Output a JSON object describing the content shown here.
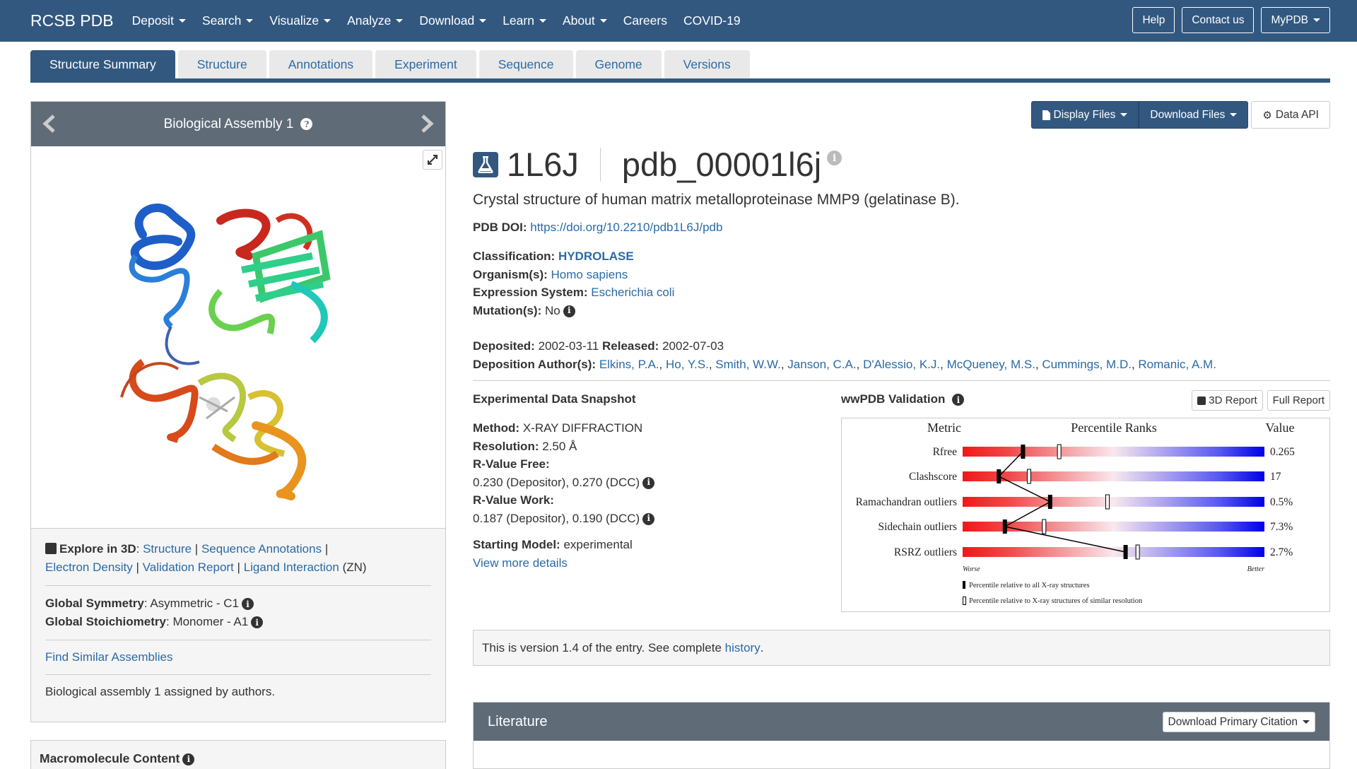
{
  "nav": {
    "brand": "RCSB PDB",
    "items": [
      "Deposit",
      "Search",
      "Visualize",
      "Analyze",
      "Download",
      "Learn",
      "About",
      "Careers",
      "COVID-19"
    ],
    "buttons": [
      "Help",
      "Contact us",
      "MyPDB"
    ]
  },
  "tabs": [
    "Structure Summary",
    "Structure",
    "Annotations",
    "Experiment",
    "Sequence",
    "Genome",
    "Versions"
  ],
  "assembly": {
    "title": "Biological Assembly 1",
    "explore_label": "Explore in 3D",
    "explore_links": [
      "Structure",
      "Sequence Annotations",
      "Electron Density",
      "Validation Report",
      "Ligand Interaction"
    ],
    "ligand_note": "(ZN)",
    "symmetry_label": "Global Symmetry",
    "symmetry_value": "Asymmetric - C1",
    "stoich_label": "Global Stoichiometry",
    "stoich_value": "Monomer - A1",
    "find_similar": "Find Similar Assemblies",
    "assigned_note": "Biological assembly 1 assigned by authors."
  },
  "toolbar": {
    "display_files": "Display Files",
    "download_files": "Download Files",
    "data_api": "Data API"
  },
  "entry": {
    "id": "1L6J",
    "ext_id": "pdb_00001l6j",
    "title": "Crystal structure of human matrix metalloproteinase MMP9 (gelatinase B).",
    "doi_label": "PDB DOI:",
    "doi": "https://doi.org/10.2210/pdb1L6J/pdb",
    "classification_label": "Classification:",
    "classification": "HYDROLASE",
    "organism_label": "Organism(s):",
    "organism": "Homo sapiens",
    "expression_label": "Expression System:",
    "expression": "Escherichia coli",
    "mutation_label": "Mutation(s):",
    "mutation": "No",
    "deposited_label": "Deposited:",
    "deposited": "2002-03-11",
    "released_label": "Released:",
    "released": "2002-07-03",
    "authors_label": "Deposition Author(s):",
    "authors": [
      "Elkins, P.A.",
      "Ho, Y.S.",
      "Smith, W.W.",
      "Janson, C.A.",
      "D'Alessio, K.J.",
      "McQueney, M.S.",
      "Cummings, M.D.",
      "Romanic, A.M."
    ]
  },
  "experimental": {
    "heading": "Experimental Data Snapshot",
    "method_label": "Method:",
    "method": "X-RAY DIFFRACTION",
    "resolution_label": "Resolution:",
    "resolution": "2.50 Å",
    "rfree_label": "R-Value Free:",
    "rfree": "0.230 (Depositor), 0.270 (DCC)",
    "rwork_label": "R-Value Work:",
    "rwork": "0.187 (Depositor), 0.190 (DCC)",
    "model_label": "Starting Model:",
    "model": "experimental",
    "more": "View more details"
  },
  "validation": {
    "heading": "wwPDB Validation",
    "report3d": "3D Report",
    "full_report": "Full Report",
    "col_metric": "Metric",
    "col_percentile": "Percentile Ranks",
    "col_value": "Value",
    "worse": "Worse",
    "better": "Better",
    "legend_all": "Percentile relative to all X-ray structures",
    "legend_similar": "Percentile relative to X-ray structures of similar resolution",
    "metrics": [
      {
        "name": "Rfree",
        "value": "0.265",
        "all": 0.2,
        "similar": 0.32
      },
      {
        "name": "Clashscore",
        "value": "17",
        "all": 0.12,
        "similar": 0.22
      },
      {
        "name": "Ramachandran outliers",
        "value": "0.5%",
        "all": 0.29,
        "similar": 0.48
      },
      {
        "name": "Sidechain outliers",
        "value": "7.3%",
        "all": 0.14,
        "similar": 0.27
      },
      {
        "name": "RSRZ outliers",
        "value": "2.7%",
        "all": 0.54,
        "similar": 0.58
      }
    ]
  },
  "version": {
    "text": "This is version 1.4 of the entry. See complete ",
    "link": "history",
    "end": "."
  },
  "literature": {
    "heading": "Literature",
    "button": "Download Primary Citation"
  },
  "macromolecule": {
    "heading": "Macromolecule Content"
  }
}
